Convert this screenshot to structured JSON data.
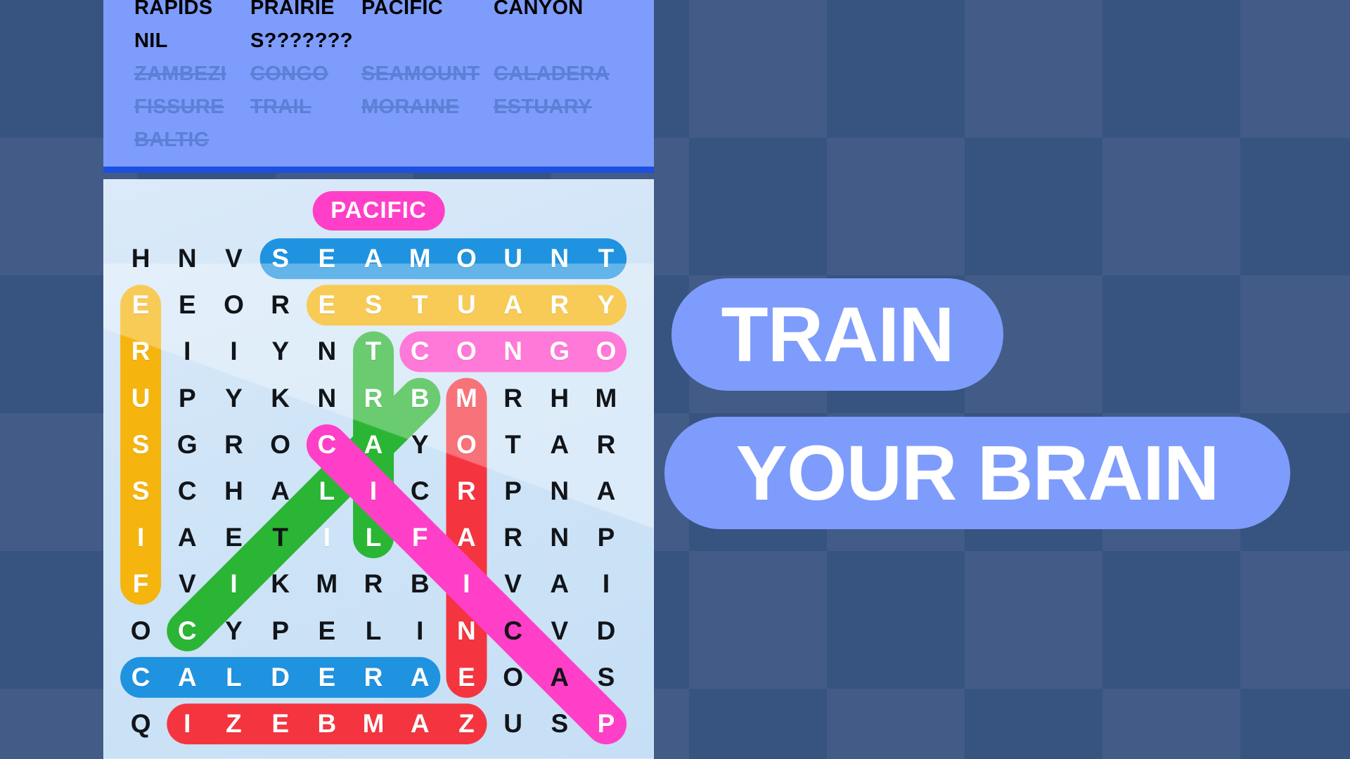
{
  "app": {
    "background_color": "#375380",
    "accent_blue": "#7e9cfb",
    "panel_divider_color": "#1d4fe0"
  },
  "word_list": {
    "columns": 4,
    "rows": [
      [
        {
          "label": "RAPIDS",
          "found": false
        },
        {
          "label": "PRAIRIE",
          "found": false
        },
        {
          "label": "PACIFIC",
          "found": false
        },
        {
          "label": "CANYON",
          "found": false
        }
      ],
      [
        {
          "label": "NIL",
          "found": false
        },
        {
          "label": "S???????",
          "found": false
        },
        {
          "label": "",
          "found": false
        },
        {
          "label": "",
          "found": false
        }
      ],
      [
        {
          "label": "ZAMBEZI",
          "found": true
        },
        {
          "label": "CONGO",
          "found": true
        },
        {
          "label": "SEAMOUNT",
          "found": true
        },
        {
          "label": "CALADERA",
          "found": true
        }
      ],
      [
        {
          "label": "FISSURE",
          "found": true
        },
        {
          "label": "TRAIL",
          "found": true
        },
        {
          "label": "MORAINE",
          "found": true
        },
        {
          "label": "ESTUARY",
          "found": true
        }
      ],
      [
        {
          "label": "BALTIC",
          "found": true
        },
        {
          "label": "",
          "found": false
        },
        {
          "label": "",
          "found": false
        },
        {
          "label": "",
          "found": false
        }
      ]
    ]
  },
  "board": {
    "current_word": "PACIFIC",
    "current_word_color": "#ff3fc8",
    "rows": 11,
    "cols": 11,
    "letters": [
      [
        "H",
        "N",
        "V",
        "S",
        "E",
        "A",
        "M",
        "O",
        "U",
        "N",
        "T"
      ],
      [
        "E",
        "E",
        "O",
        "R",
        "E",
        "S",
        "T",
        "U",
        "A",
        "R",
        "Y"
      ],
      [
        "R",
        "I",
        "I",
        "Y",
        "N",
        "T",
        "C",
        "O",
        "N",
        "G",
        "O"
      ],
      [
        "U",
        "P",
        "Y",
        "K",
        "N",
        "R",
        "B",
        "M",
        "R",
        "H",
        "M"
      ],
      [
        "S",
        "G",
        "R",
        "O",
        "C",
        "A",
        "Y",
        "O",
        "T",
        "A",
        "R"
      ],
      [
        "S",
        "C",
        "H",
        "A",
        "L",
        "I",
        "C",
        "R",
        "P",
        "N",
        "A"
      ],
      [
        "I",
        "A",
        "E",
        "T",
        "I",
        "L",
        "F",
        "A",
        "R",
        "N",
        "P"
      ],
      [
        "F",
        "V",
        "I",
        "K",
        "M",
        "R",
        "B",
        "I",
        "V",
        "A",
        "I"
      ],
      [
        "O",
        "C",
        "Y",
        "P",
        "E",
        "L",
        "I",
        "N",
        "C",
        "V",
        "D"
      ],
      [
        "C",
        "A",
        "L",
        "D",
        "E",
        "R",
        "A",
        "E",
        "O",
        "A",
        "S"
      ],
      [
        "Q",
        "I",
        "Z",
        "E",
        "B",
        "M",
        "A",
        "Z",
        "U",
        "S",
        "P"
      ]
    ],
    "highlights": [
      {
        "word": "SEAMOUNT",
        "color": "#1f93e0",
        "shape": "line",
        "from": [
          0,
          3
        ],
        "to": [
          0,
          10
        ]
      },
      {
        "word": "ESTUARY",
        "color": "#f5b50e",
        "shape": "line",
        "from": [
          1,
          4
        ],
        "to": [
          1,
          10
        ]
      },
      {
        "word": "FISSURE",
        "color": "#f5b50e",
        "shape": "line",
        "from": [
          1,
          0
        ],
        "to": [
          7,
          0
        ]
      },
      {
        "word": "CONGO",
        "color": "#ff3fc8",
        "shape": "line",
        "from": [
          2,
          6
        ],
        "to": [
          2,
          10
        ]
      },
      {
        "word": "TRAIL",
        "color": "#2bb534",
        "shape": "line",
        "from": [
          2,
          5
        ],
        "to": [
          6,
          5
        ]
      },
      {
        "word": "BALTIC",
        "color": "#2bb534",
        "shape": "line",
        "from": [
          3,
          6
        ],
        "to": [
          8,
          1
        ]
      },
      {
        "word": "MORAINE",
        "color": "#f4353f",
        "shape": "line",
        "from": [
          3,
          7
        ],
        "to": [
          9,
          7
        ]
      },
      {
        "word": "CALDERA",
        "color": "#1f93e0",
        "shape": "line",
        "from": [
          9,
          0
        ],
        "to": [
          9,
          6
        ]
      },
      {
        "word": "ZAMBEZI",
        "color": "#f4353f",
        "shape": "line",
        "from": [
          10,
          1
        ],
        "to": [
          10,
          7
        ]
      },
      {
        "word": "PACIFIC",
        "color": "#ff3fc8",
        "shape": "line",
        "from": [
          4,
          4
        ],
        "to": [
          10,
          10
        ]
      }
    ],
    "highlighted_cells": [
      [
        0,
        3
      ],
      [
        0,
        4
      ],
      [
        0,
        5
      ],
      [
        0,
        6
      ],
      [
        0,
        7
      ],
      [
        0,
        8
      ],
      [
        0,
        9
      ],
      [
        0,
        10
      ],
      [
        1,
        0
      ],
      [
        1,
        4
      ],
      [
        1,
        5
      ],
      [
        1,
        6
      ],
      [
        1,
        7
      ],
      [
        1,
        8
      ],
      [
        1,
        9
      ],
      [
        1,
        10
      ],
      [
        2,
        0
      ],
      [
        2,
        5
      ],
      [
        2,
        6
      ],
      [
        2,
        7
      ],
      [
        2,
        8
      ],
      [
        2,
        9
      ],
      [
        2,
        10
      ],
      [
        3,
        0
      ],
      [
        3,
        5
      ],
      [
        3,
        6
      ],
      [
        3,
        7
      ],
      [
        4,
        0
      ],
      [
        4,
        4
      ],
      [
        4,
        5
      ],
      [
        4,
        7
      ],
      [
        5,
        0
      ],
      [
        5,
        4
      ],
      [
        5,
        5
      ],
      [
        5,
        7
      ],
      [
        6,
        0
      ],
      [
        6,
        4
      ],
      [
        6,
        5
      ],
      [
        6,
        6
      ],
      [
        6,
        7
      ],
      [
        7,
        0
      ],
      [
        7,
        2
      ],
      [
        7,
        7
      ],
      [
        8,
        1
      ],
      [
        8,
        7
      ],
      [
        9,
        0
      ],
      [
        9,
        1
      ],
      [
        9,
        2
      ],
      [
        9,
        3
      ],
      [
        9,
        4
      ],
      [
        9,
        5
      ],
      [
        9,
        6
      ],
      [
        9,
        7
      ],
      [
        10,
        1
      ],
      [
        10,
        2
      ],
      [
        10,
        3
      ],
      [
        10,
        4
      ],
      [
        10,
        5
      ],
      [
        10,
        6
      ],
      [
        10,
        7
      ],
      [
        10,
        10
      ]
    ]
  },
  "promo": {
    "line1": "TRAIN",
    "line2": "YOUR BRAIN",
    "pill_color": "#7e9cfb",
    "text_color": "#ffffff"
  }
}
